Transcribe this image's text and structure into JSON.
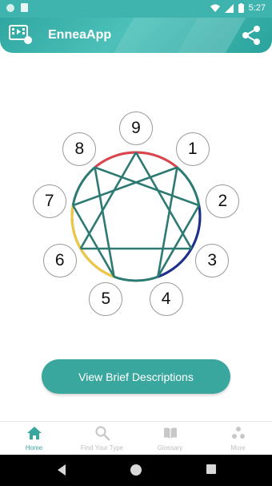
{
  "status_bar": {
    "time": "5:27"
  },
  "app_bar": {
    "title": "EnneaApp"
  },
  "enneagram": {
    "numbers": [
      "1",
      "2",
      "3",
      "4",
      "5",
      "6",
      "7",
      "8",
      "9"
    ],
    "arc_colors": {
      "top": "#e0454e",
      "right": "#1f2f8c",
      "left": "#f1c83d",
      "circle": "#2d7a73"
    }
  },
  "main": {
    "primary_button": "View Brief Descriptions"
  },
  "bottom_nav": {
    "items": [
      {
        "label": "Home",
        "icon": "home-icon"
      },
      {
        "label": "Find Your Type",
        "icon": "search-icon"
      },
      {
        "label": "Glossary",
        "icon": "book-icon"
      },
      {
        "label": "More",
        "icon": "more-dots-icon"
      }
    ]
  },
  "colors": {
    "accent": "#3aa79f",
    "status_bar": "#3fb3ad"
  }
}
